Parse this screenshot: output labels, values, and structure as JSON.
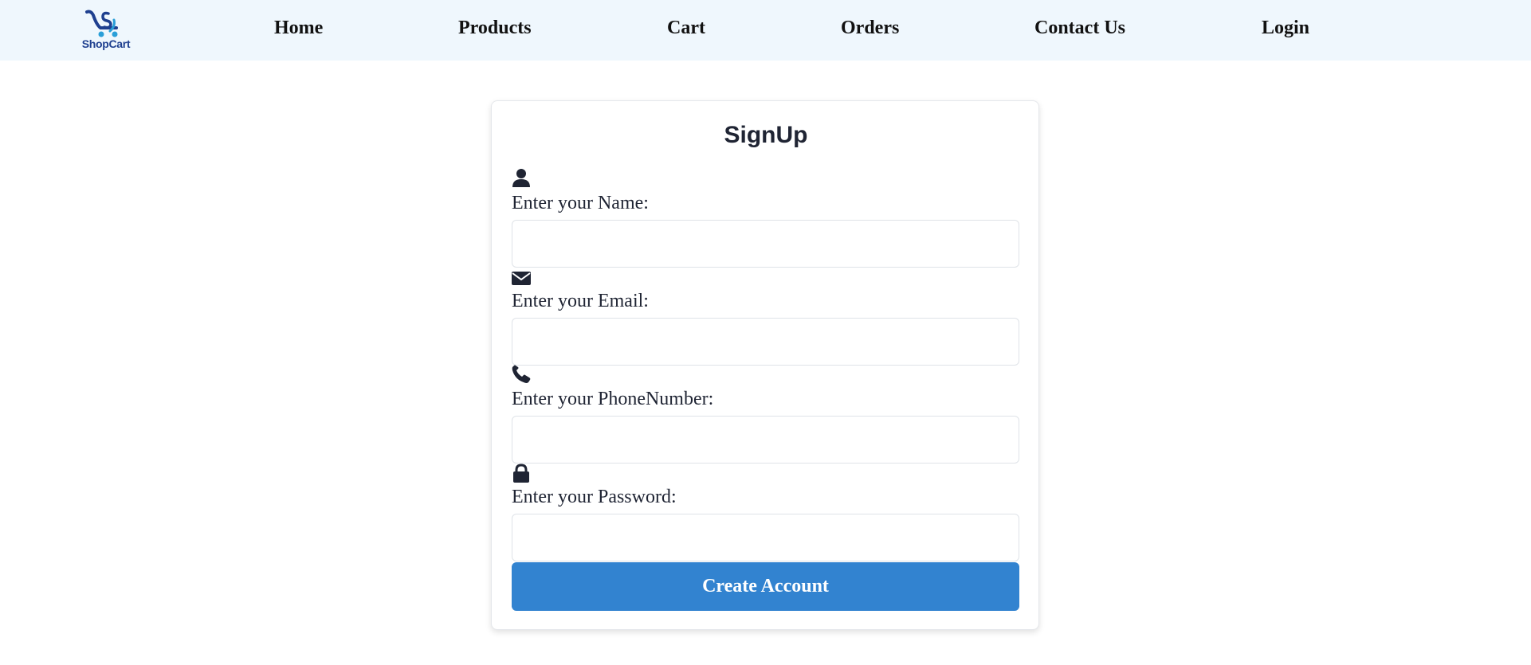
{
  "brand": {
    "name": "ShopCart",
    "colors": {
      "primary": "#1e3f8f",
      "accent": "#2a9fd8"
    }
  },
  "nav": {
    "items": [
      {
        "label": "Home"
      },
      {
        "label": "Products"
      },
      {
        "label": "Cart"
      },
      {
        "label": "Orders"
      },
      {
        "label": "Contact Us"
      },
      {
        "label": "Login"
      }
    ]
  },
  "signup": {
    "title": "SignUp",
    "fields": [
      {
        "icon": "user-icon",
        "label": "Enter your Name:",
        "value": "",
        "placeholder": ""
      },
      {
        "icon": "envelope-icon",
        "label": "Enter your Email:",
        "value": "",
        "placeholder": ""
      },
      {
        "icon": "phone-icon",
        "label": "Enter your PhoneNumber:",
        "value": "",
        "placeholder": ""
      },
      {
        "icon": "lock-icon",
        "label": "Enter your Password:",
        "value": "",
        "placeholder": ""
      }
    ],
    "submit_label": "Create Account"
  },
  "colors": {
    "nav_background": "#eff7fd",
    "button": "#3283d0",
    "text": "#1f2433"
  }
}
